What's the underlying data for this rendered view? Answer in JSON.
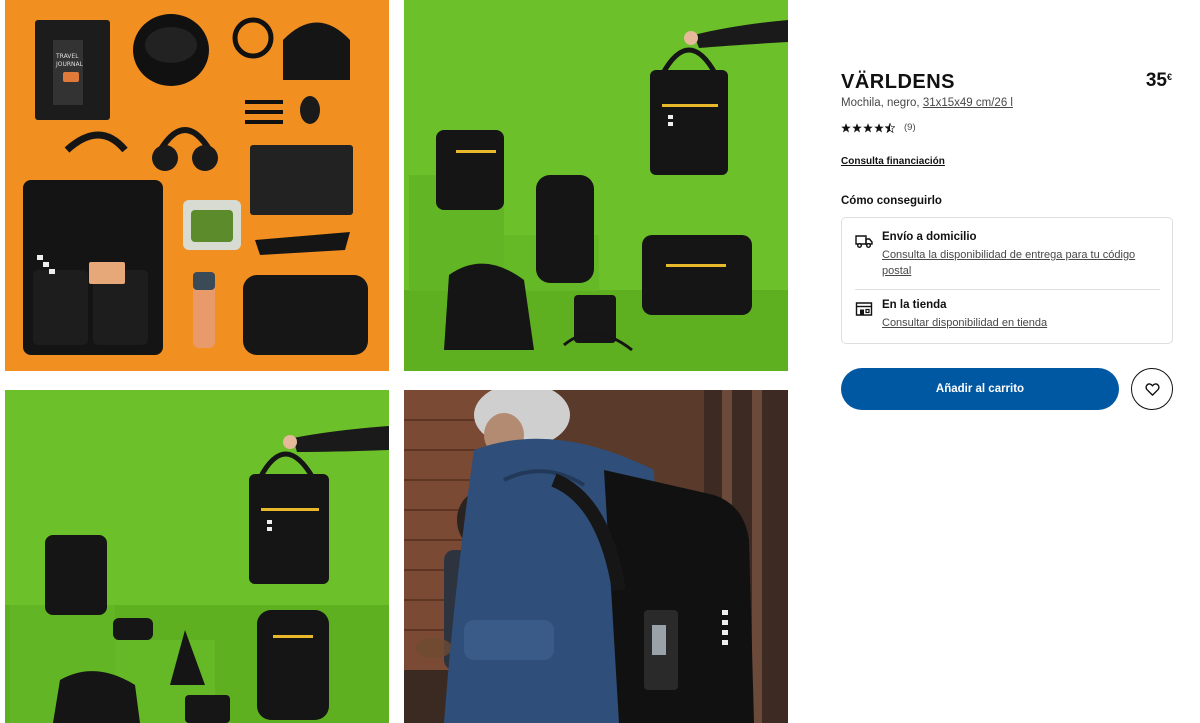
{
  "product": {
    "name": "VÄRLDENS",
    "price": "35",
    "currency": "€",
    "description_prefix": "Mochila, negro, ",
    "measure": "31x15x49 cm/26 l",
    "rating_value": 4.5,
    "rating_count": "(9)"
  },
  "links": {
    "financing": "Consulta financiación"
  },
  "availability": {
    "heading": "Cómo conseguirlo",
    "delivery_title": "Envío a domicilio",
    "delivery_link": "Consulta la disponibilidad de entrega para tu código postal",
    "store_title": "En la tienda",
    "store_link": "Consultar disponibilidad en tienda"
  },
  "actions": {
    "add_to_cart": "Añadir al carrito"
  },
  "gallery": {
    "photos": [
      "product-flatlay-photo",
      "product-range-photo-1",
      "product-range-photo-2",
      "lifestyle-photo"
    ]
  },
  "colors": {
    "primary_blue": "#0058a3",
    "orange_bg": "#f08a1c",
    "green_bg": "#6cc12a"
  }
}
